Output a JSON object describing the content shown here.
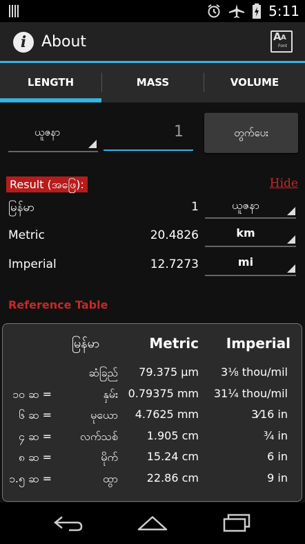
{
  "status_bar": {
    "time": "5:11",
    "icons": [
      "alarm-icon",
      "airplane-icon",
      "battery-icon"
    ]
  },
  "action_bar": {
    "title": "About",
    "info_icon": "info-icon",
    "font_icon": "font-icon",
    "font_icon_text": "Font"
  },
  "tabs": [
    {
      "label": "LENGTH",
      "selected": true
    },
    {
      "label": "MASS",
      "selected": false
    },
    {
      "label": "VOLUME",
      "selected": false
    }
  ],
  "input": {
    "unit": "ယူဇနာ",
    "value": "1",
    "convert_label": "တွက်ပေး"
  },
  "result": {
    "label": "Result (အဖြေ):",
    "hide_link": "Hide",
    "rows": [
      {
        "label": "မြန်မာ",
        "value": "1",
        "unit": "ယူဇနာ"
      },
      {
        "label": "Metric",
        "value": "20.4826",
        "unit": "km"
      },
      {
        "label": "Imperial",
        "value": "12.7273",
        "unit": "mi"
      }
    ]
  },
  "reference": {
    "title": "Reference Table",
    "headers": [
      "မြန်မာ",
      "Metric",
      "Imperial"
    ],
    "rows": [
      {
        "prefix": "",
        "name": "ဆံခြည်",
        "metric": "79.375 µm",
        "imperial": "3⅛ thou/mil"
      },
      {
        "prefix": "၁၀ ဆ =",
        "name": "နှမ်း",
        "metric": "0.79375 mm",
        "imperial": "31¼ thou/mil"
      },
      {
        "prefix": "၆ ဆ =",
        "name": "မုယော",
        "metric": "4.7625 mm",
        "imperial": "3⁄16 in"
      },
      {
        "prefix": "၄ ဆ =",
        "name": "လက်သစ်",
        "metric": "1.905 cm",
        "imperial": "¾ in"
      },
      {
        "prefix": "၈ ဆ =",
        "name": "မိုက်",
        "metric": "15.24 cm",
        "imperial": "6 in"
      },
      {
        "prefix": "၁.၅ ဆ =",
        "name": "ထွာ",
        "metric": "22.86 cm",
        "imperial": "9 in"
      }
    ]
  },
  "colors": {
    "accent": "#33b5e5",
    "result_bg": "#b71c1c",
    "link": "#c62828"
  }
}
